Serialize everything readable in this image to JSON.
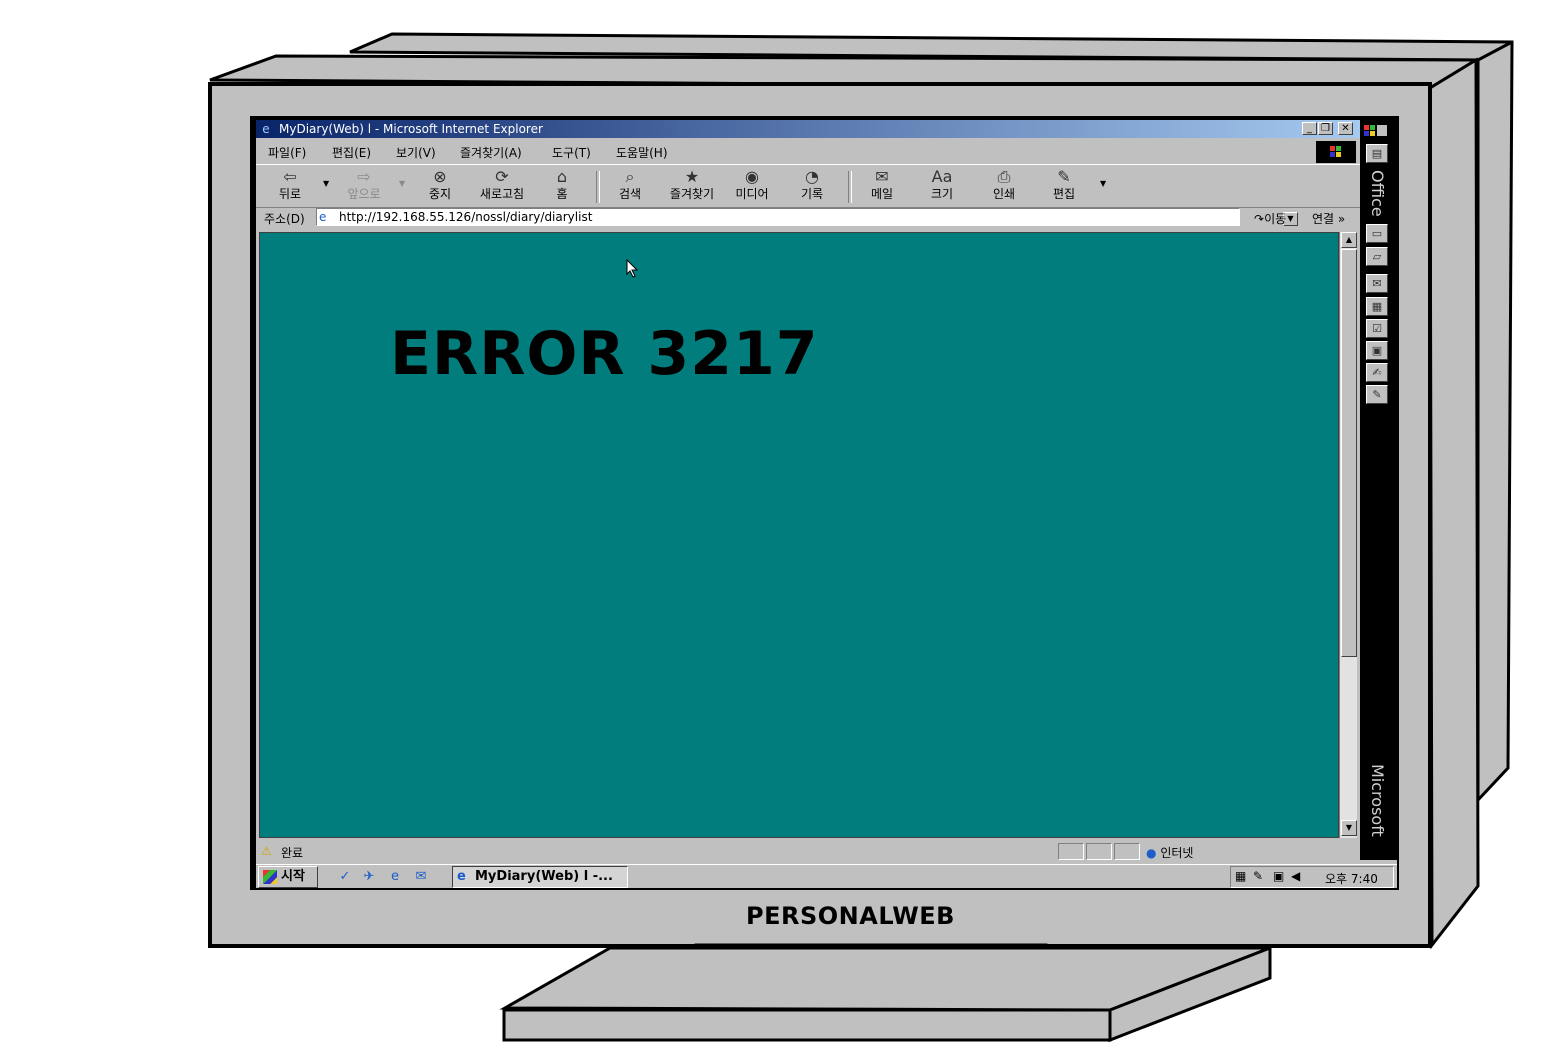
{
  "browser": {
    "title": "MyDiary(Web) l - Microsoft Internet Explorer",
    "menu": [
      "파일(F)",
      "편집(E)",
      "보기(V)",
      "즐겨찾기(A)",
      "도구(T)",
      "도움말(H)"
    ],
    "toolbar": {
      "back": "뒤로",
      "forward": "앞으로",
      "stop": "중지",
      "refresh": "새로고침",
      "home": "홈",
      "search": "검색",
      "favorites": "즐겨찾기",
      "media": "미디어",
      "history": "기록",
      "mail": "메일",
      "size": "크기",
      "print": "인쇄",
      "edit": "편집"
    },
    "address": {
      "label": "주소(D)",
      "url": "http://192.168.55.126/nossl/diary/diarylist",
      "go": "이동",
      "links": "연결 »"
    },
    "status": {
      "text": "완료",
      "zone": "인터넷"
    }
  },
  "page": {
    "error_text": "ERROR 3217"
  },
  "taskbar": {
    "start": "시작",
    "task": "MyDiary(Web) l -...",
    "clock": "오후 7:40"
  },
  "office_bar": {
    "top": "Office",
    "bottom": "Microsoft"
  },
  "monitor": {
    "brand": "PERSONALWEB"
  },
  "colors": {
    "page_bg": "#017d7d",
    "title_start": "#0a246a",
    "title_end": "#a6caf0",
    "chrome": "#c0c0c0"
  },
  "icons": {
    "back": "arrow-left-icon",
    "forward": "arrow-right-icon",
    "stop": "stop-icon",
    "refresh": "refresh-icon",
    "home": "home-icon",
    "search": "search-icon",
    "favorites": "favorites-icon",
    "media": "media-icon",
    "history": "history-icon",
    "mail": "mail-icon",
    "size": "font-size-icon",
    "print": "print-icon",
    "edit": "edit-icon"
  }
}
